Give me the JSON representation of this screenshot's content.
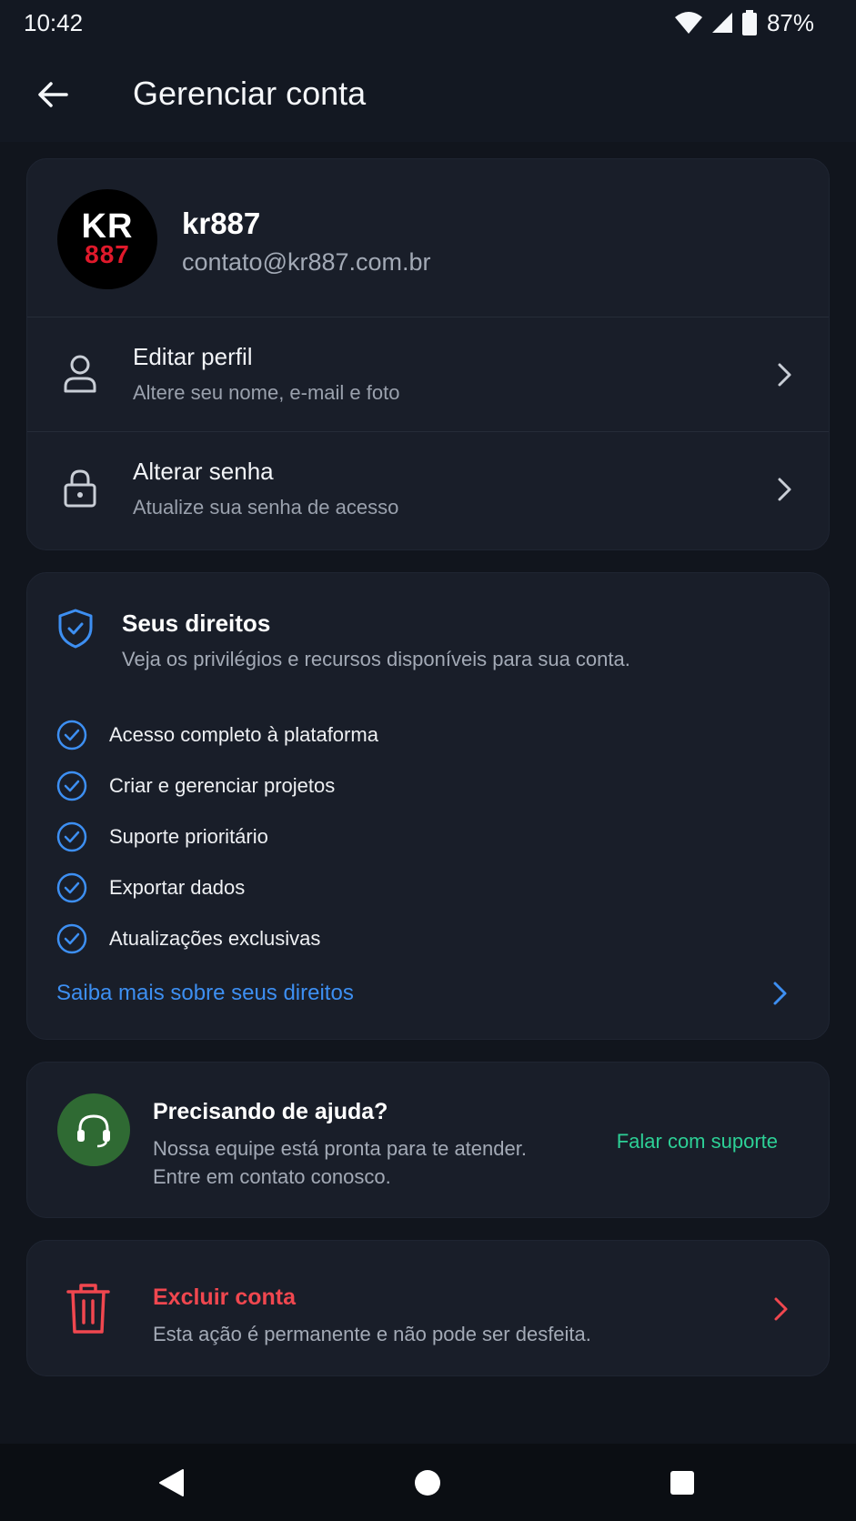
{
  "status_bar": {
    "time": "10:42",
    "battery_text": "87%",
    "icons": [
      "wifi-icon",
      "signal-icon",
      "battery-icon"
    ]
  },
  "app_bar": {
    "title": "Gerenciar conta",
    "back_icon": "arrow-left-icon"
  },
  "profile": {
    "avatar_top": "KR",
    "avatar_bottom": "887",
    "name": "kr887",
    "email": "contato@kr887.com.br",
    "menu": [
      {
        "title": "Editar perfil",
        "subtitle": "Altere seu nome, e-mail e foto",
        "icon": "user-icon"
      },
      {
        "title": "Alterar senha",
        "subtitle": "Atualize sua senha de acesso",
        "icon": "lock-icon"
      }
    ]
  },
  "rights": {
    "title": "Seus direitos",
    "subtitle": "Veja os privilégios e recursos disponíveis para sua conta.",
    "items": [
      "Acesso completo à plataforma",
      "Criar e gerenciar projetos",
      "Suporte prioritário",
      "Exportar dados",
      "Atualizações exclusivas"
    ],
    "link": "Saiba mais sobre seus direitos"
  },
  "help": {
    "title": "Precisando de ajuda?",
    "line1": "Nossa equipe está pronta para te atender.",
    "line2": "Entre em contato conosco.",
    "action": "Falar com suporte"
  },
  "delete": {
    "title": "Excluir conta",
    "subtitle": "Esta ação é permanente e não pode ser desfeita."
  },
  "colors": {
    "background": "#11151d",
    "card": "#191e29",
    "accent_blue": "#3d8ff2",
    "accent_green": "#2dd096",
    "danger": "#f0474f",
    "avatar_red": "#e0192b"
  }
}
